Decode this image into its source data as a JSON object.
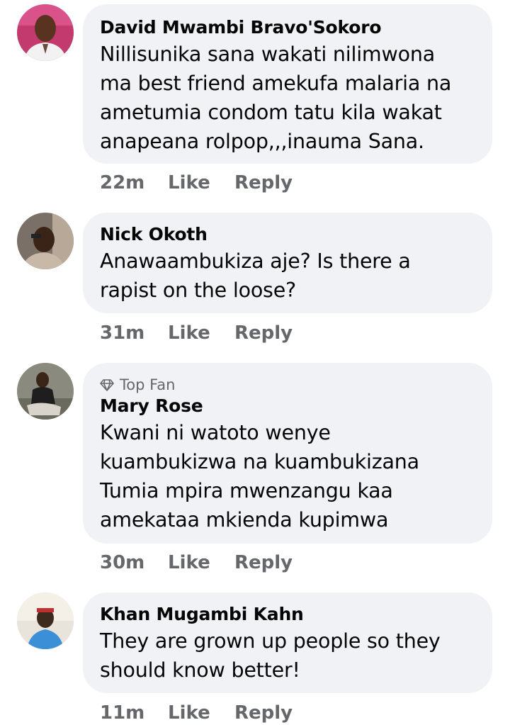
{
  "comments": [
    {
      "name": "David Mwambi Bravo'Sokoro",
      "badge": "",
      "text": [
        "Nillisunika sana wakati nilimwona",
        "ma best friend amekufa malaria na",
        "ametumia condom tatu kila wakat",
        "anapeana rolpop,,,inauma Sana."
      ],
      "time": "22m",
      "like": "Like",
      "reply": "Reply"
    },
    {
      "name": "Nick Okoth",
      "badge": "",
      "text": [
        "Anawaambukiza aje? Is there a",
        "rapist on the loose?"
      ],
      "time": "31m",
      "like": "Like",
      "reply": "Reply"
    },
    {
      "name": "Mary Rose",
      "badge": "Top Fan",
      "text": [
        "Kwani ni watoto wenye",
        "kuambukizwa na kuambukizana",
        "Tumia mpira mwenzangu kaa",
        "amekataa mkienda kupimwa"
      ],
      "time": "30m",
      "like": "Like",
      "reply": "Reply"
    },
    {
      "name": "Khan Mugambi Kahn",
      "badge": "",
      "text": [
        "They are grown up people so they",
        "should know better!"
      ],
      "time": "11m",
      "like": "Like",
      "reply": "Reply"
    }
  ],
  "colors": {
    "bubble": "#f0f2f5",
    "meta": "#65676b",
    "text": "#050505"
  }
}
